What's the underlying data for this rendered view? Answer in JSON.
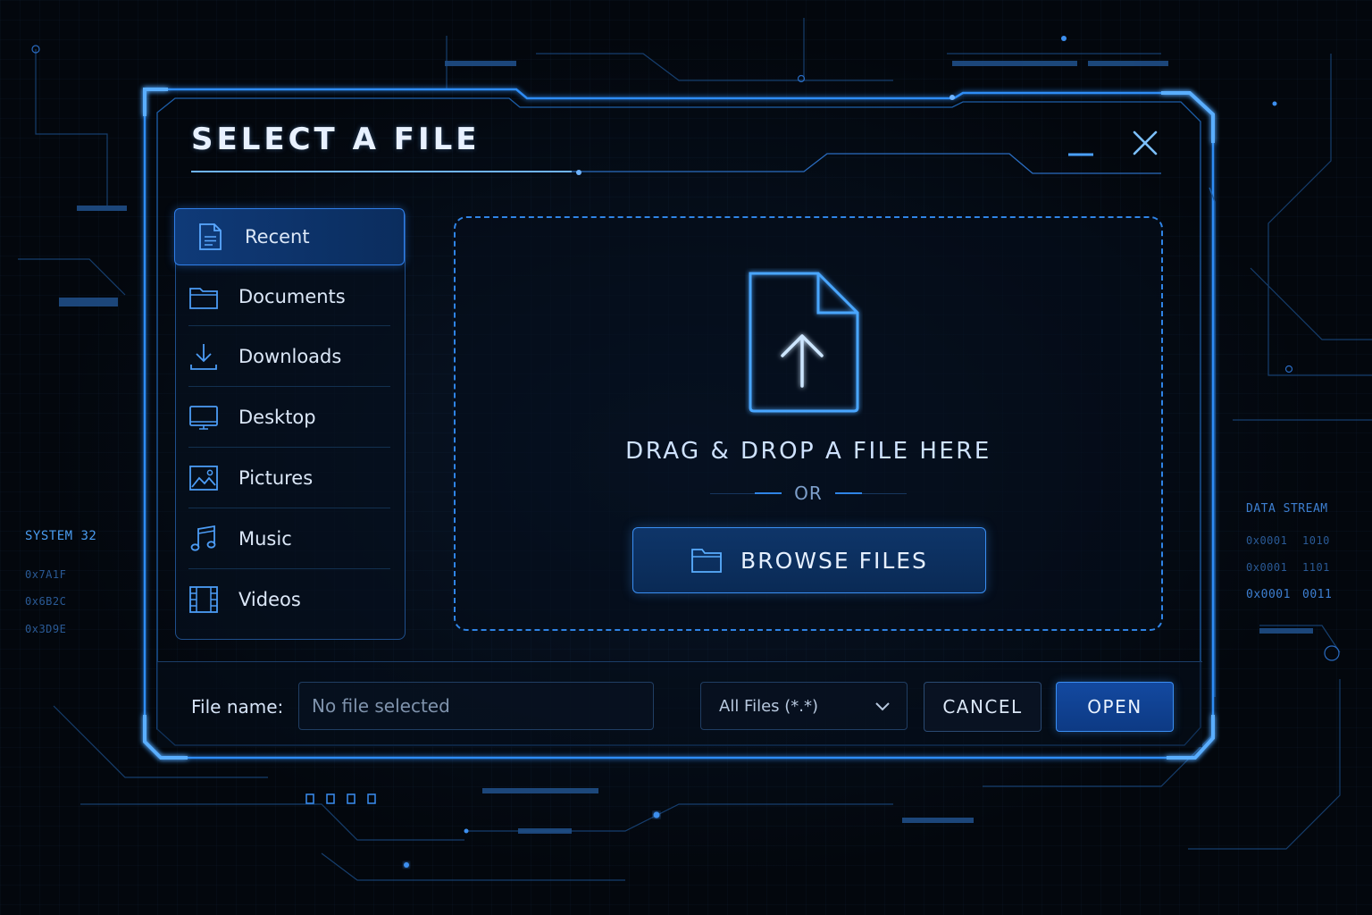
{
  "dialog": {
    "title": "SELECT A FILE",
    "minimize_icon": "minimize-icon",
    "close_icon": "close-icon"
  },
  "sidebar": {
    "items": [
      {
        "label": "Recent",
        "icon": "document-icon",
        "active": true
      },
      {
        "label": "Documents",
        "icon": "folder-icon",
        "active": false
      },
      {
        "label": "Downloads",
        "icon": "download-icon",
        "active": false
      },
      {
        "label": "Desktop",
        "icon": "monitor-icon",
        "active": false
      },
      {
        "label": "Pictures",
        "icon": "image-icon",
        "active": false
      },
      {
        "label": "Music",
        "icon": "music-note-icon",
        "active": false
      },
      {
        "label": "Videos",
        "icon": "film-icon",
        "active": false
      }
    ]
  },
  "dropzone": {
    "icon": "file-upload-icon",
    "text": "DRAG & DROP A FILE HERE",
    "or_text": "OR",
    "browse_label": "BROWSE FILES",
    "browse_icon": "folder-icon"
  },
  "footer": {
    "file_name_label": "File name:",
    "file_name_placeholder": "No file selected",
    "file_type_selected": "All Files (*.*)",
    "cancel_label": "CANCEL",
    "open_label": "OPEN"
  },
  "decor": {
    "left_panel_title": "SYSTEM 32",
    "left_codes": [
      "0x7A1F",
      "0x6B2C",
      "0x3D9E"
    ],
    "right_panel_title": "DATA STREAM",
    "right_rows": [
      {
        "addr": "0x0001",
        "bits": "1010"
      },
      {
        "addr": "0x0001",
        "bits": "1101"
      },
      {
        "addr": "0x0001",
        "bits": "0011"
      }
    ]
  },
  "colors": {
    "accent": "#2f84e6",
    "background": "#03070d",
    "active_item": "#0f3a78",
    "text": "#dbe7f7"
  }
}
